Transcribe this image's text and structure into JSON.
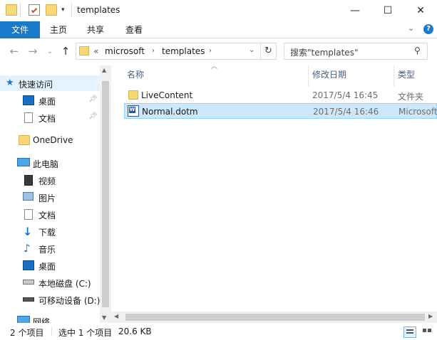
{
  "window": {
    "title": "templates",
    "controls": {
      "minimize": "—",
      "maximize": "☐",
      "close": "✕"
    }
  },
  "ribbon": {
    "tabs": [
      "文件",
      "主页",
      "共享",
      "查看"
    ],
    "expand_icon": "chevron-down-icon",
    "help_icon": "help-icon"
  },
  "address": {
    "overflow": "«",
    "crumbs": [
      "microsoft",
      "templates"
    ],
    "search_placeholder": "搜索\"templates\""
  },
  "sidebar": {
    "quick_access": "快速访问",
    "quick_items": [
      "桌面",
      "文档"
    ],
    "onedrive": "OneDrive",
    "this_pc": "此电脑",
    "pc_items": [
      "视频",
      "图片",
      "文档",
      "下载",
      "音乐",
      "桌面",
      "本地磁盘 (C:)",
      "可移动设备 (D:)"
    ],
    "network": "网络"
  },
  "content": {
    "columns": {
      "name": "名称",
      "date": "修改日期",
      "type": "类型"
    },
    "rows": [
      {
        "name": "LiveContent",
        "date": "2017/5/4 16:45",
        "type": "文件夹",
        "icon": "folder-icon"
      },
      {
        "name": "Normal.dotm",
        "date": "2017/5/4 16:46",
        "type": "Microsoft",
        "icon": "word-template-icon",
        "selected": true
      }
    ]
  },
  "status": {
    "count": "2 个项目",
    "selection": "选中 1 个项目",
    "size": "20.6 KB"
  },
  "colors": {
    "accent": "#1979ca",
    "selection": "#cce8ff",
    "folder": "#f8d775"
  }
}
